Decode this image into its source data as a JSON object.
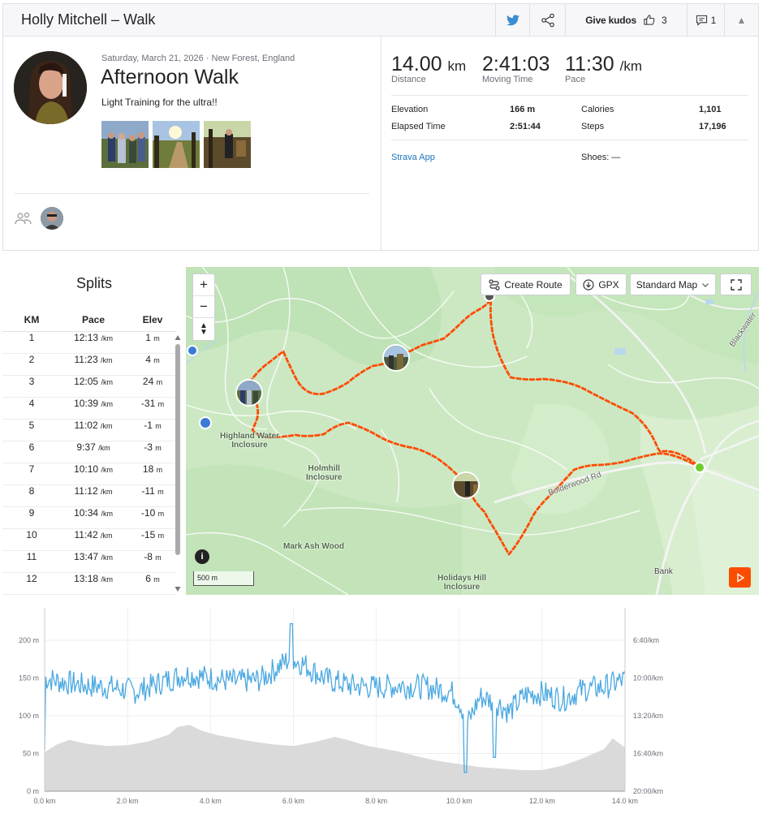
{
  "header": {
    "athlete_activity": "Holly Mitchell – Walk",
    "twitter_icon": "twitter-icon",
    "share_icon": "share-icon",
    "kudos_label": "Give kudos",
    "kudos_count": "3",
    "comment_count": "1"
  },
  "activity": {
    "date_location": "Saturday, March 21, 2026 · New Forest, England",
    "title": "Afternoon Walk",
    "description": "Light Training for the ultra!!"
  },
  "stats": {
    "distance": {
      "value": "14.00",
      "unit": "km",
      "label": "Distance"
    },
    "moving_time": {
      "value": "2:41:03",
      "label": "Moving Time"
    },
    "pace": {
      "value": "11:30",
      "unit": "/km",
      "label": "Pace"
    },
    "elevation_label": "Elevation",
    "elevation": "166 m",
    "elapsed_label": "Elapsed Time",
    "elapsed": "2:51:44",
    "calories_label": "Calories",
    "calories": "1,101",
    "steps_label": "Steps",
    "steps": "17,196",
    "device": "Strava App",
    "shoes": "Shoes: —"
  },
  "splits": {
    "title": "Splits",
    "headers": {
      "km": "KM",
      "pace": "Pace",
      "elev": "Elev"
    },
    "pace_unit": "/km",
    "elev_unit": "m",
    "rows": [
      {
        "km": "1",
        "pace": "12:13",
        "elev": "1"
      },
      {
        "km": "2",
        "pace": "11:23",
        "elev": "4"
      },
      {
        "km": "3",
        "pace": "12:05",
        "elev": "24"
      },
      {
        "km": "4",
        "pace": "10:39",
        "elev": "-31"
      },
      {
        "km": "5",
        "pace": "11:02",
        "elev": "-1"
      },
      {
        "km": "6",
        "pace": "9:37",
        "elev": "-3"
      },
      {
        "km": "7",
        "pace": "10:10",
        "elev": "18"
      },
      {
        "km": "8",
        "pace": "11:12",
        "elev": "-11"
      },
      {
        "km": "9",
        "pace": "10:34",
        "elev": "-10"
      },
      {
        "km": "10",
        "pace": "11:42",
        "elev": "-15"
      },
      {
        "km": "11",
        "pace": "13:47",
        "elev": "-8"
      },
      {
        "km": "12",
        "pace": "13:18",
        "elev": "6"
      }
    ]
  },
  "map": {
    "create_route": "Create Route",
    "gpx": "GPX",
    "map_style": "Standard Map",
    "scale": "500 m",
    "labels": {
      "highland": "Highland Water\nInclosure",
      "holmhill": "Holmhill\nInclosure",
      "mark_ash": "Mark Ash Wood",
      "holidays": "Holidays Hill\nInclosure",
      "bolderwood": "Bolderwood Rd",
      "blackwater": "Blackwater",
      "bank": "Bank"
    },
    "route_color": "#fc4c02"
  },
  "chart_data": {
    "type": "area",
    "x_ticks": [
      "0.0 km",
      "2.0 km",
      "4.0 km",
      "6.0 km",
      "8.0 km",
      "10.0 km",
      "12.0 km",
      "14.0 km"
    ],
    "x_range": [
      0,
      14
    ],
    "left_ticks": [
      "0 m",
      "50 m",
      "100 m",
      "150 m",
      "200 m"
    ],
    "left_range": [
      0,
      200
    ],
    "right_ticks": [
      "20:00/km",
      "16:40/km",
      "13:20/km",
      "10:00/km",
      "6:40/km"
    ],
    "elevation_m": [
      [
        0,
        52
      ],
      [
        0.3,
        62
      ],
      [
        0.6,
        68
      ],
      [
        1,
        63
      ],
      [
        1.5,
        60
      ],
      [
        2,
        61
      ],
      [
        2.5,
        66
      ],
      [
        3,
        75
      ],
      [
        3.2,
        85
      ],
      [
        3.5,
        88
      ],
      [
        3.8,
        80
      ],
      [
        4.2,
        74
      ],
      [
        4.6,
        70
      ],
      [
        5,
        66
      ],
      [
        5.5,
        62
      ],
      [
        6,
        60
      ],
      [
        6.5,
        65
      ],
      [
        7,
        72
      ],
      [
        7.3,
        68
      ],
      [
        7.8,
        60
      ],
      [
        8.2,
        56
      ],
      [
        8.6,
        52
      ],
      [
        9,
        46
      ],
      [
        9.5,
        40
      ],
      [
        10,
        36
      ],
      [
        10.5,
        32
      ],
      [
        11,
        30
      ],
      [
        11.5,
        28
      ],
      [
        12,
        28
      ],
      [
        12.5,
        34
      ],
      [
        13,
        44
      ],
      [
        13.5,
        56
      ],
      [
        13.7,
        70
      ],
      [
        14,
        58
      ]
    ],
    "pace_color": "#4aa8e0",
    "elevation_color": "#d9d9d9"
  }
}
